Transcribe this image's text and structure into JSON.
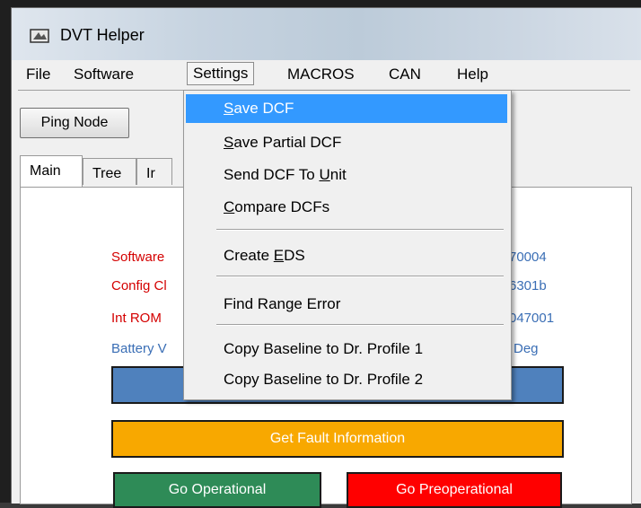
{
  "window": {
    "title": "DVT Helper"
  },
  "menubar": {
    "items": [
      {
        "label": "File",
        "active": false
      },
      {
        "label": "Software",
        "active": false
      },
      {
        "label": "Settings",
        "active": true
      },
      {
        "label": "MACROS",
        "active": false
      },
      {
        "label": "CAN",
        "active": false
      },
      {
        "label": "Help",
        "active": false
      }
    ]
  },
  "toolbar": {
    "ping_label": "Ping Node"
  },
  "tabs": [
    {
      "label": "Main",
      "selected": true
    },
    {
      "label": "Tree",
      "selected": false
    },
    {
      "label": "Ir",
      "selected": false
    }
  ],
  "info_rows": [
    {
      "label": "Software",
      "value": "70004",
      "color": "red"
    },
    {
      "label": "Config Cl",
      "value": "6301b",
      "color": "red"
    },
    {
      "label": "Int ROM",
      "value": "047001",
      "color": "red"
    },
    {
      "label": "Battery V",
      "value": "Deg",
      "color": "blue"
    }
  ],
  "buttons": {
    "fault_label": "Get Fault Information",
    "operational_label": "Go Operational",
    "preoperational_label": "Go Preoperational"
  },
  "settings_menu": {
    "items": [
      {
        "pre": "",
        "ul": "S",
        "post": "ave DCF",
        "highlighted": true
      },
      {
        "pre": "",
        "ul": "S",
        "post": "ave Partial DCF",
        "highlighted": false
      },
      {
        "pre": "Send DCF To ",
        "ul": "U",
        "post": "nit",
        "highlighted": false
      },
      {
        "pre": "",
        "ul": "C",
        "post": "ompare DCFs",
        "highlighted": false
      },
      {
        "pre": "Create ",
        "ul": "E",
        "post": "DS",
        "highlighted": false
      },
      {
        "pre": "Find Range Error",
        "ul": "",
        "post": "",
        "highlighted": false
      },
      {
        "pre": "Copy Baseline to Dr. Profile 1",
        "ul": "",
        "post": "",
        "highlighted": false
      },
      {
        "pre": "Copy Baseline to Dr. Profile 2",
        "ul": "",
        "post": "",
        "highlighted": false
      }
    ]
  },
  "colors": {
    "highlight": "#3399ff",
    "label_red": "#d40000",
    "label_blue": "#3a6eb5",
    "bar_blue": "#4f81bd",
    "bar_orange": "#f8a800",
    "bar_green": "#2e8b57",
    "bar_red": "#ff0000"
  }
}
